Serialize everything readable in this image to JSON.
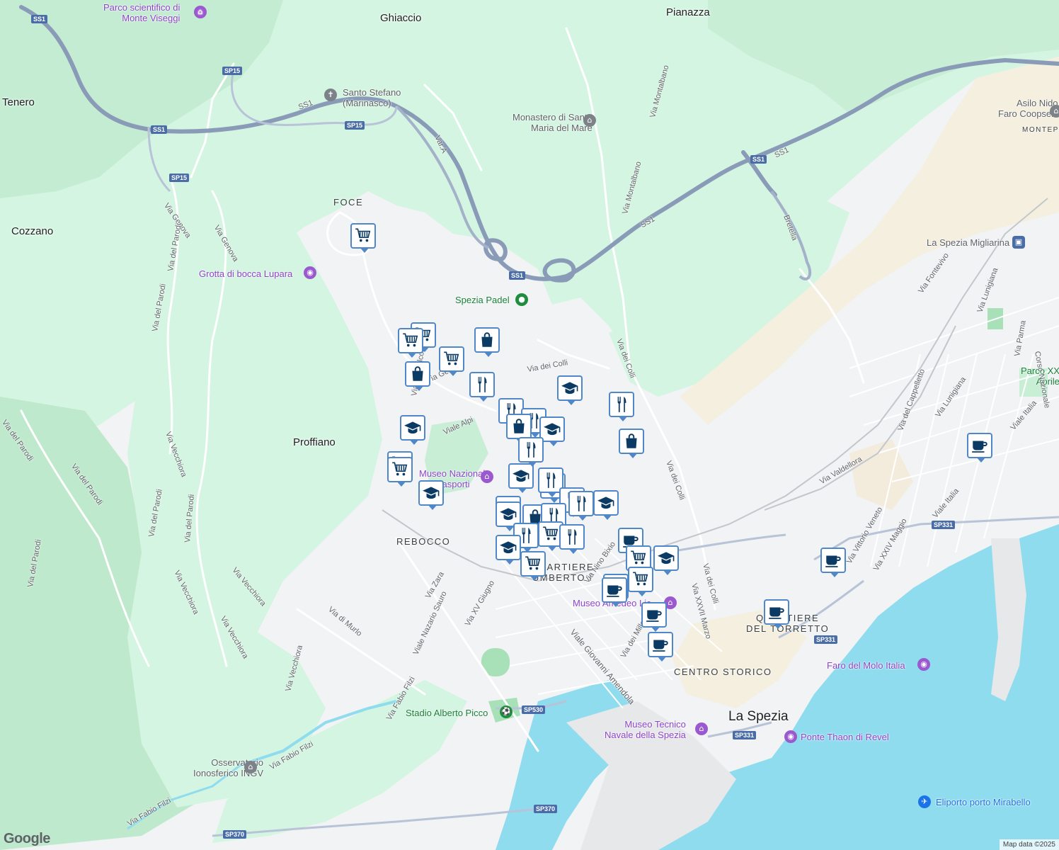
{
  "map": {
    "attribution": "Map data ©2025",
    "logo": "Google",
    "colors": {
      "land": "#f1f3f4",
      "park": "#d4f5e1",
      "forest": "#bfe9cd",
      "water": "#8fdcef",
      "highway": "#8a9bb8",
      "road": "#ffffff",
      "sand": "#f4efdf",
      "marker_border": "#4f87c9",
      "marker_icon": "#0b3b64"
    }
  },
  "places": [
    {
      "id": "ghiaccio",
      "text": "Ghiaccio"
    },
    {
      "id": "pianazza",
      "text": "Pianazza"
    },
    {
      "id": "tenero",
      "text": "Tenero"
    },
    {
      "id": "cozzano",
      "text": "Cozzano"
    },
    {
      "id": "proffiano",
      "text": "Proffiano"
    }
  ],
  "districts": [
    {
      "id": "foce",
      "text": "FOCE"
    },
    {
      "id": "rebocco",
      "text": "REBOCCO"
    },
    {
      "id": "quartiere-umberto",
      "text": "QUARTIERE\nUMBERTO I"
    },
    {
      "id": "quartiere-torretto",
      "text": "QUARTIERE\nDEL TORRETTO"
    },
    {
      "id": "centro-storico",
      "text": "CENTRO STORICO"
    },
    {
      "id": "montepertico",
      "text": "MONTEPERT"
    }
  ],
  "city": {
    "text": "La Spezia"
  },
  "pois": [
    {
      "id": "parco-scientifico",
      "text": "Parco scientifico di\nMonte Viseggi",
      "icon": "museum-icon"
    },
    {
      "id": "santo-stefano",
      "text": "Santo Stefano\n(Marinasco)",
      "icon": "church-icon"
    },
    {
      "id": "monastero",
      "text": "Monastero di Santa\nMaria del Mare",
      "icon": "landmark-icon"
    },
    {
      "id": "asilo",
      "text": "Asilo Nido Il\nFaro Coopselios",
      "icon": "school-icon"
    },
    {
      "id": "grotta",
      "text": "Grotta di bocca Lupara",
      "icon": "camera-icon"
    },
    {
      "id": "spezia-padel",
      "text": "Spezia Padel",
      "icon": "pin-icon"
    },
    {
      "id": "migliarina",
      "text": "La Spezia Migliarina",
      "icon": "train-icon"
    },
    {
      "id": "parco-xxv",
      "text": "Parco XX\nAprile",
      "icon": "park-icon"
    },
    {
      "id": "museo-nazionale",
      "text": "Museo Nazionale\ndei Trasporti",
      "icon": "museum-icon"
    },
    {
      "id": "museo-lia",
      "text": "Museo Amedeo Lia",
      "icon": "museum-icon"
    },
    {
      "id": "faro-molo",
      "text": "Faro del Molo Italia",
      "icon": "camera-icon"
    },
    {
      "id": "stadio",
      "text": "Stadio Alberto Picco",
      "icon": "stadium-icon"
    },
    {
      "id": "museo-tecnico",
      "text": "Museo Tecnico\nNavale della Spezia",
      "icon": "museum-icon"
    },
    {
      "id": "ponte-thaon",
      "text": "Ponte Thaon di Revel",
      "icon": "camera-icon"
    },
    {
      "id": "osservatorio",
      "text": "Osservatorio\nIonosferico INGV",
      "icon": "landmark-icon"
    },
    {
      "id": "eliporto",
      "text": "Eliporto porto Mirabello",
      "icon": "airport-icon"
    }
  ],
  "shields": [
    "SS1",
    "SP15",
    "SS1",
    "SP15",
    "SP15",
    "SS1",
    "SS1",
    "SP331",
    "SP331",
    "SP331",
    "SP530",
    "SP370",
    "SP370"
  ],
  "streets": [
    "Via Genova",
    "Via Genova",
    "Via del Parodi",
    "Via del Parodi",
    "Via del Parodi",
    "Via del Parodi",
    "Via del Parodi",
    "Via del Parodi",
    "Via del Parodi",
    "Via Vecchiora",
    "Via Vecchiora",
    "Via Vecchiora",
    "Via Vecchiora",
    "Via Vecchiora",
    "Via Montalbano",
    "Via Montalbano",
    "Bretella",
    "Var.A",
    "SS1",
    "SS1",
    "SS1",
    "Via dei Colli",
    "Via dei Colli",
    "Via dei Colli",
    "Via dei Colli",
    "Viale Alpi",
    "Via Monfalcone",
    "Via Zara",
    "Via di Murlo",
    "Viale Nazario Sauro",
    "Via XV Giugno",
    "Via Fabio Filzi",
    "Via Fabio Filzi",
    "Via Fabio Filzi",
    "Viale Giovanni Amendola",
    "Via Nino Bixio",
    "Via dei Mille",
    "Via XXVII Marzo",
    "Via Fontevivo",
    "Via Lunigiana",
    "Via Lunigiana",
    "Via del Cappelletto",
    "Via Valdellora",
    "Via Vittorio Veneto",
    "Via XXIV Maggio",
    "Viale Italia",
    "Viale Italia",
    "Via Parma",
    "Corso Nazionale",
    "Via Genova"
  ],
  "markers": [
    {
      "id": "m1",
      "icon": "cart-icon"
    },
    {
      "id": "m2",
      "icon": "cart-icon"
    },
    {
      "id": "m3",
      "icon": "cart-icon"
    },
    {
      "id": "m4",
      "icon": "bag-icon"
    },
    {
      "id": "m5",
      "icon": "cart-icon"
    },
    {
      "id": "m6",
      "icon": "bag-icon"
    },
    {
      "id": "m7",
      "icon": "fork-knife-icon"
    },
    {
      "id": "m8",
      "icon": "grad-cap-icon"
    },
    {
      "id": "m9",
      "icon": "fork-knife-icon"
    },
    {
      "id": "m10",
      "icon": "fork-knife-icon"
    },
    {
      "id": "m11",
      "icon": "bag-icon"
    },
    {
      "id": "m12",
      "icon": "grad-cap-icon"
    },
    {
      "id": "m13",
      "icon": "grad-cap-icon"
    },
    {
      "id": "m14",
      "icon": "fork-knife-icon"
    },
    {
      "id": "m15",
      "icon": "bag-icon"
    },
    {
      "id": "m16",
      "icon": "cart-icon"
    },
    {
      "id": "m17",
      "icon": "cart-icon"
    },
    {
      "id": "m18",
      "icon": "grad-cap-icon"
    },
    {
      "id": "m19",
      "icon": "grad-cap-icon"
    },
    {
      "id": "m20",
      "icon": "fork-knife-icon"
    },
    {
      "id": "m21",
      "icon": "coffee-icon"
    },
    {
      "id": "m22",
      "icon": "fork-knife-icon"
    },
    {
      "id": "m23",
      "icon": "fork-knife-icon"
    },
    {
      "id": "m24",
      "icon": "fork-knife-icon"
    },
    {
      "id": "m25",
      "icon": "grad-cap-icon"
    },
    {
      "id": "m26",
      "icon": "grad-cap-icon"
    },
    {
      "id": "m27",
      "icon": "bag-icon"
    },
    {
      "id": "m28",
      "icon": "grad-cap-icon"
    },
    {
      "id": "m29",
      "icon": "fork-knife-icon"
    },
    {
      "id": "m30",
      "icon": "cart-icon"
    },
    {
      "id": "m31",
      "icon": "fork-knife-icon"
    },
    {
      "id": "m32",
      "icon": "fork-knife-icon"
    },
    {
      "id": "m33",
      "icon": "grad-cap-icon"
    },
    {
      "id": "m34",
      "icon": "cart-icon"
    },
    {
      "id": "m35",
      "icon": "coffee-icon"
    },
    {
      "id": "m36",
      "icon": "cart-icon"
    },
    {
      "id": "m37",
      "icon": "grad-cap-icon"
    },
    {
      "id": "m38",
      "icon": "cart-icon"
    },
    {
      "id": "m39",
      "icon": "cart-icon"
    },
    {
      "id": "m40",
      "icon": "coffee-icon"
    },
    {
      "id": "m41",
      "icon": "coffee-icon"
    },
    {
      "id": "m42",
      "icon": "coffee-icon"
    },
    {
      "id": "m43",
      "icon": "coffee-icon"
    },
    {
      "id": "m44",
      "icon": "coffee-icon"
    },
    {
      "id": "m45",
      "icon": "coffee-icon"
    }
  ]
}
